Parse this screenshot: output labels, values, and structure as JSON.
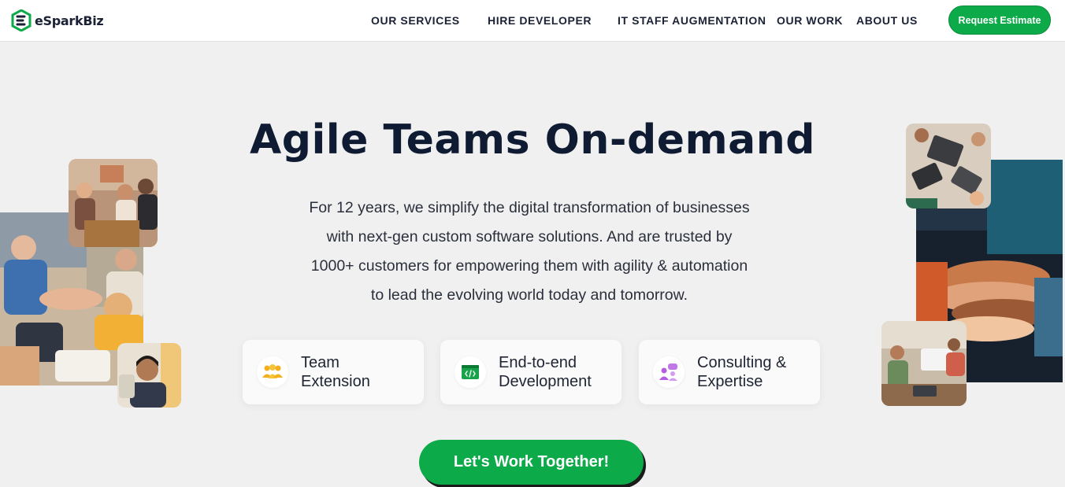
{
  "header": {
    "logo_text": "eSparkBiz",
    "nav": [
      {
        "label": "OUR SERVICES"
      },
      {
        "label": "HIRE DEVELOPER"
      },
      {
        "label": "IT STAFF AUGMENTATION"
      },
      {
        "label": "OUR WORK"
      },
      {
        "label": "ABOUT US"
      }
    ],
    "cta_label": "Request Estimate"
  },
  "hero": {
    "title": "Agile Teams On-demand",
    "description_lines": [
      "For 12 years, we simplify the digital transformation of businesses",
      "with next-gen custom software solutions. And are trusted by",
      "1000+ customers for empowering them with agility & automation",
      "to lead the evolving world today and tomorrow."
    ],
    "features": [
      {
        "line1": "Team",
        "line2": "Extension",
        "icon": "team-icon"
      },
      {
        "line1": "End-to-end",
        "line2": "Development",
        "icon": "code-window-icon"
      },
      {
        "line1": "Consulting &",
        "line2": "Expertise",
        "icon": "consulting-icon"
      }
    ],
    "cta_label": "Let's Work Together!"
  },
  "colors": {
    "brand_green": "#0daa4a",
    "title_navy": "#0f1b33",
    "background": "#f0f0f0"
  }
}
